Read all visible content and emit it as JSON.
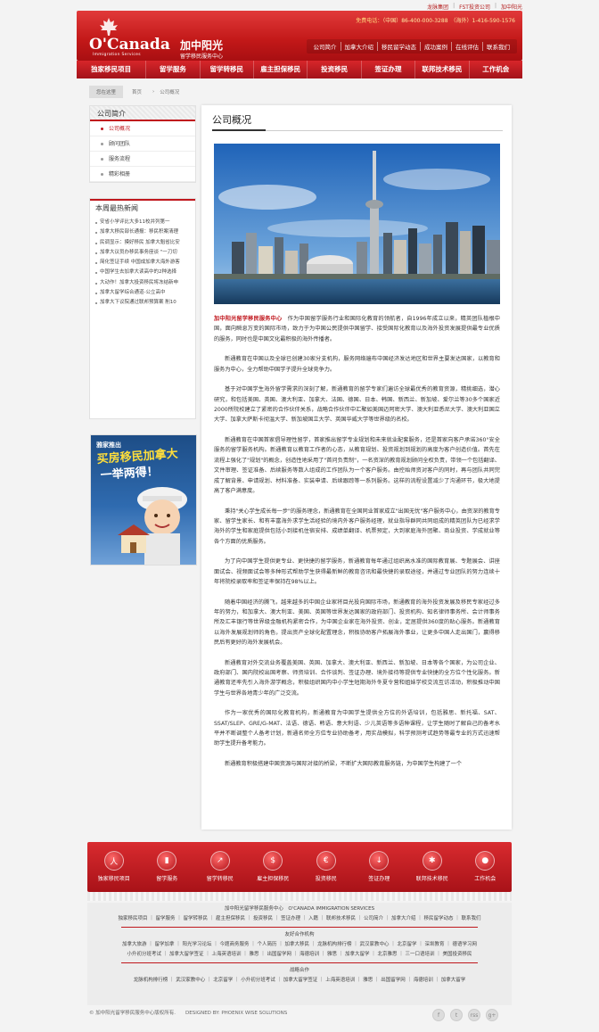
{
  "top_links": [
    "龙脉集团",
    "FST投资公司",
    "加中阳光"
  ],
  "header": {
    "brand_en": "O'Canada",
    "brand_sub": "Immigration Services",
    "brand_cn": "加中阳光",
    "brand_cn2": "留学移民服务中心",
    "hotline_label": "免费电话：",
    "hotline": "（中国）86-400-000-3288　（海外）1-416-590-1576",
    "subnav": [
      "公司简介",
      "加拿大介绍",
      "移民留学动态",
      "成功案例",
      "在线评估",
      "联系我们"
    ]
  },
  "mainnav": [
    "独家移民项目",
    "留学服务",
    "留学转移民",
    "雇主担保移民",
    "投资移民",
    "签证办理",
    "联邦技术移民",
    "工作机会"
  ],
  "breadcrumb": {
    "here": "您在这里",
    "home": "首页",
    "current": "公司概况"
  },
  "sidebar": {
    "title": "公司简介",
    "items": [
      {
        "label": "公司概况",
        "active": true
      },
      {
        "label": "顾问团队",
        "active": false
      },
      {
        "label": "服务流程",
        "active": false
      },
      {
        "label": "精彩相册",
        "active": false
      }
    ]
  },
  "news": {
    "title": "本周最热新闻",
    "items": [
      "安省小学评比大多11校并列第一",
      "加拿大移民部长通报：移民积案清理",
      "民调显示：摸好移民 加拿大魁省比安",
      "加拿大议员办移民事务座谈 \"一刀切",
      "简化签证手续 中国成加拿大海外游客",
      "中国学生去加拿大读高中的2种选择",
      "大动作！加拿大投资移民将冻结新申",
      "加拿大留学综合通道-公立高中",
      "加拿大下议院通过联邦预算案 削10"
    ]
  },
  "promo": {
    "line1": "雅家推出",
    "line2": "买房移民加拿大",
    "line3": "一举两得！"
  },
  "content": {
    "title": "公司概况",
    "paragraphs": [
      {
        "lead": "加中阳光留学移民服务中心",
        "text": "　作为中国留学服务行业和国际化教育的领航者，自1996年成立以来，精英团队植根中国，面向瞬息万变的国际市场，致力于为中国公民提供中国留学、接受国际化教育以及海外投资发展提供最专业优质的服务，同时也是中国文化最积极的海外传播者。"
      },
      {
        "lead": "",
        "text": "新通教育在中国以及全球已创建30家分支机构，服务网络遍布中国经济发达地区和世界主要发达国家，以教育和服务为中心，全力帮助中国学子提升全球竞争力。"
      },
      {
        "lead": "",
        "text": "基于对中国学生海外留学需求的深刻了解，新通教育的留学专家们遍访全球最优秀的教育资源，精挑细选，潜心研究，和包括美国、英国、澳大利亚、加拿大、法国、德国、日本、韩国、新西兰、新加坡、爱尔兰等30多个国家近2000所院校建立了紧密的合作伙伴关系，战略合作伙伴中汇聚如美国迈阿密大学、澳大利亚悉尼大学、澳大利亚国立大学、加拿大萨斯卡彻温大学、新加坡国立大学、英国华威大学等世界级的名校。"
      },
      {
        "lead": "",
        "text": "新通教育在中国首家倡导理性留学，首家推出留学专业规划和未来就业配套服务，还是首家向客户承诺360°安全服务的留学服务机构。新通教育以教育工作者的心态，从教育规划、投资规划到规划的高度为客户创造价值。首先在流程上强化了\"规划\"的概念，创造性地采用了\"首问负责制\"，一名资深的教育规划顾问全权负责，带领一个包括翻译、文件审理、签证准备、后续服务等数人组成的工作团队为一个客户服务。由控始师资对客户的同时，再与团队共同完成了解背景、申请规划、材料准备、实装申请、后续跟踪等一系列服务。这样的流程设置减少了沟通环节，极大地提高了客户满意度。"
      },
      {
        "lead": "",
        "text": "秉持\"关心学生成长每一步\"的服务理念，新通教育在全国同业首家成立\"出国无忧\"客户服务中心，由资深的教育专家、留学生家长、和有丰富海外求学生活经验的境内外客户服务经理，就业指导群同共同组成的精英团队为已经求学海外的学生和家庭提供包括小到接机住宿安排、成绩单翻译、机票预定，大到家庭海外团聚、商业投资、学成就业等各个方面的优质服务。"
      },
      {
        "lead": "",
        "text": "为了向中国学生提供更专业、更快捷的留学服务，新通教育每年通过组织高水准的国际教育展、专题展会、讲座面试会、视频面试会等多种形式帮助学生获得最新鲜的教育咨讯和最快捷的录取途径，并通过专业团队的努力连续十年将院校录取率和签证率保持在98%以上。"
      },
      {
        "lead": "",
        "text": "随着中国经济的腾飞，越来越多的中国企业家将目光投向国际市场，新通教育的海外投资发展及移民专家经过多年的努力，和加拿大、澳大利亚、美国、英国等世界发达国家的政府部门、投资机构、知名律师事务所、会计师事务所及汇丰银行等世界级金融机构紧密合作，为中国企业家在海外投资、创业，定居提供360度的贴心服务。新通教育以海外发展规划师的角色，提出资产全球化配置理念，积极协助客户拓展海外事业，让更多中国人走出国门，赢得移民后有更好的海外发展机会。"
      },
      {
        "lead": "",
        "text": "新通教育对外交流业务覆盖美国、英国、加拿大、澳大利亚、新西兰、新加坡、日本等各个国家，为公司企业、政府部门、国内院校出国考察、师资培训、合作谈判、签证办理、境外接待等提供专业快捷的全方位个性化服务。新通教育还率先引入海外游学概念，积极组织国内中小学生短期海外冬夏令营和姐妹学校交流互访活动，积极推动中国学生与世界各地青少年的广泛交流。"
      },
      {
        "lead": "",
        "text": "作为一家优秀的国际化教育机构，新通教育为中国学生提供全方位的外语培训，包括雅思、新托福、SAT、SSAT/SLEP、GRE/G-MAT、法语、德语、韩语、意大利语、少儿英语等多语种课程，让学生随时了解自己的备考水平并不断调整个人备考计划，新通名师全方位专业协助备考，用实战模拟，科学预测考试趋势等最专业的方式迅速帮助学生提升备考能力。"
      },
      {
        "lead": "",
        "text": "新通教育积极搭建中国资源与国际对接的桥梁，不断扩大国际教育服务链，为中国学生构建了一个"
      }
    ]
  },
  "footer": {
    "items": [
      {
        "label": "独家移民项目",
        "icon": "人"
      },
      {
        "label": "留学服务",
        "icon": "▮"
      },
      {
        "label": "留学转移民",
        "icon": "↗"
      },
      {
        "label": "雇主担保移民",
        "icon": "$"
      },
      {
        "label": "投资移民",
        "icon": "€"
      },
      {
        "label": "签证办理",
        "icon": "↓"
      },
      {
        "label": "联邦技术移民",
        "icon": "✱"
      },
      {
        "label": "工作机会",
        "icon": "●"
      }
    ],
    "org_line": "加中阳光留学移民服务中心　O'CANADA IMMIGRATION SERVICES",
    "links_row1": "独家移民项目 ｜ 留学服务 ｜ 留学转移民 ｜ 雇主担保移民 ｜ 投资移民 ｜ 签证办理 ｜ 入籍 ｜ 联邦技术移民 ｜ 公司简介 ｜ 加拿大介绍 ｜ 移民留学动态 ｜ 联系我们",
    "partners_title": "友好合作机构",
    "partners_row1": "加拿大旅游 ｜ 留学加拿 ｜ 阳光学习论坛 ｜ 今题商务服务 ｜ 个人简历 ｜ 加拿大移民 ｜ 龙脉机构排行榜 ｜ 武汉家教中心 ｜ 北京留学 ｜ 深圳教育 ｜ 德语学习网",
    "partners_row2": "小升初分班考试 ｜ 加拿大留学签证 ｜ 上海英语培训 ｜ 雅思 ｜ 出国留学网 ｜ 海德培训 ｜ 雅思 ｜ 加拿大留学 ｜ 北京雅思 ｜ 三一口语培训 ｜ 美国投资移民",
    "strategic_title": "战略合作",
    "strategic_row": "龙脉机构排行榜 ｜ 武汉家教中心 ｜ 北京留学 ｜ 小升初分班考试 ｜ 加拿大留学签证 ｜ 上海英语培训 ｜ 雅思 ｜ 出国留学网 ｜ 海德培训 ｜ 加拿大留学",
    "copyright": "© 加中阳光留学移民服务中心版权所有.　　DESIGNED BY: PHOENIX WISE SOLUTIONS",
    "social": [
      "f",
      "t",
      "rss",
      "g+"
    ]
  }
}
